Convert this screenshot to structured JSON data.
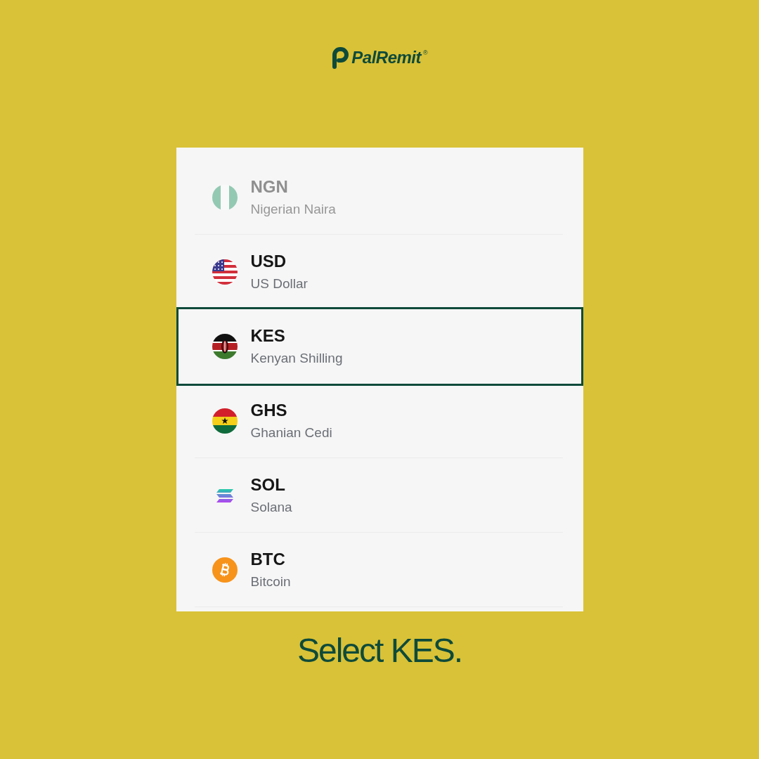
{
  "logo": {
    "name": "PalRemit",
    "mark": "®"
  },
  "currencies": [
    {
      "code": "NGN",
      "name": "Nigerian Naira",
      "kind": "ngn",
      "selected": false,
      "disabled": true
    },
    {
      "code": "USD",
      "name": "US Dollar",
      "kind": "usd",
      "selected": false,
      "disabled": false
    },
    {
      "code": "KES",
      "name": "Kenyan Shilling",
      "kind": "kes",
      "selected": true,
      "disabled": false
    },
    {
      "code": "GHS",
      "name": "Ghanian Cedi",
      "kind": "ghs",
      "selected": false,
      "disabled": false
    },
    {
      "code": "SOL",
      "name": "Solana",
      "kind": "sol",
      "selected": false,
      "disabled": false
    },
    {
      "code": "BTC",
      "name": "Bitcoin",
      "kind": "btc",
      "selected": false,
      "disabled": false
    }
  ],
  "caption": "Select KES."
}
